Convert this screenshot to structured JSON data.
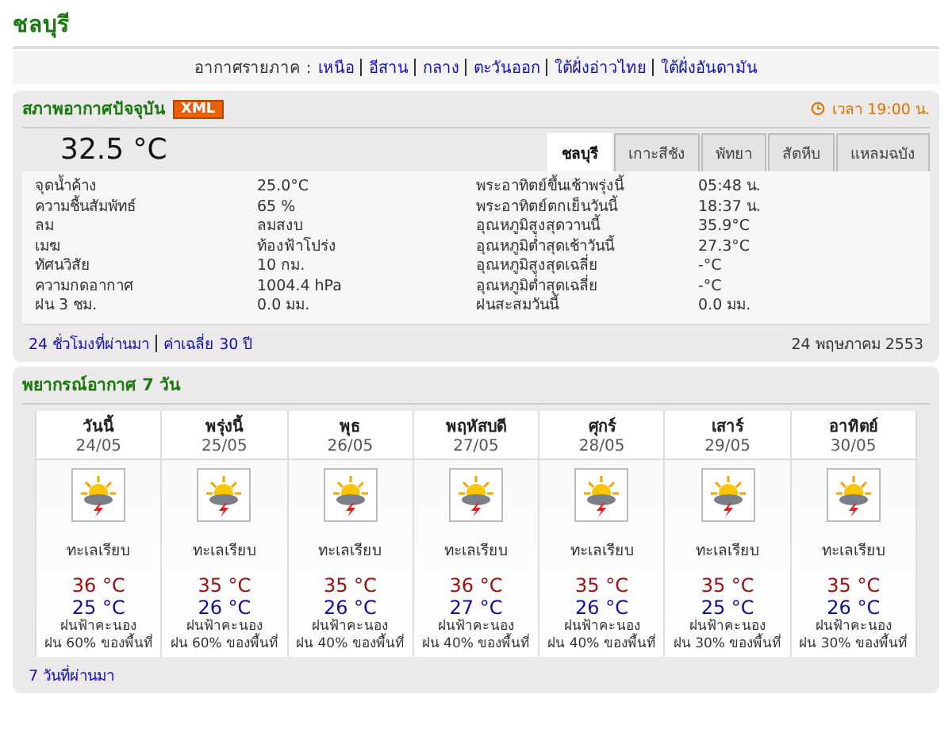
{
  "page_title": "ชลบุรี",
  "region_nav": {
    "label": "อากาศรายภาค :",
    "links": [
      "เหนือ",
      "อีสาน",
      "กลาง",
      "ตะวันออก",
      "ใต้ฝั่งอ่าวไทย",
      "ใต้ฝั่งอันดามัน"
    ]
  },
  "current": {
    "title": "สภาพอากาศปัจจุบัน",
    "badge": "XML",
    "time": "เวลา 19:00 น.",
    "temperature": "32.5 °C",
    "tabs": [
      {
        "label": "ชลบุรี",
        "selected": true
      },
      {
        "label": "เกาะสีชัง",
        "selected": false
      },
      {
        "label": "พัทยา",
        "selected": false
      },
      {
        "label": "สัตหีบ",
        "selected": false
      },
      {
        "label": "แหลมฉบัง",
        "selected": false
      }
    ],
    "left": [
      {
        "label": "จุดน้ำค้าง",
        "value": "25.0°C"
      },
      {
        "label": "ความชื้นสัมพัทธ์",
        "value": "65 %"
      },
      {
        "label": "ลม",
        "value": "ลมสงบ"
      },
      {
        "label": "เมฆ",
        "value": "ท้องฟ้าโปร่ง"
      },
      {
        "label": "ทัศนวิสัย",
        "value": "10 กม."
      },
      {
        "label": "ความกดอากาศ",
        "value": "1004.4 hPa"
      },
      {
        "label": "ฝน 3 ชม.",
        "value": "0.0 มม."
      }
    ],
    "right": [
      {
        "label": "พระอาทิตย์ขึ้นเช้าพรุ่งนี้",
        "value": "05:48 น."
      },
      {
        "label": "พระอาทิตย์ตกเย็นวันนี้",
        "value": "18:37 น."
      },
      {
        "label": "อุณหภูมิสูงสุดวานนี้",
        "value": "35.9°C"
      },
      {
        "label": "อุณหภูมิต่ำสุดเช้าวันนี้",
        "value": "27.3°C"
      },
      {
        "label": "อุณหภูมิสูงสุดเฉลี่ย",
        "value": "-°C"
      },
      {
        "label": "อุณหภูมิต่ำสุดเฉลี่ย",
        "value": "-°C"
      },
      {
        "label": "ฝนสะสมวันนี้",
        "value": "0.0 มม."
      }
    ],
    "footer_links": [
      "24 ชั่วโมงที่ผ่านมา",
      "ค่าเฉลี่ย 30 ปี"
    ],
    "date": "24 พฤษภาคม 2553"
  },
  "forecast": {
    "title": "พยากรณ์อากาศ 7 วัน",
    "days": [
      {
        "day": "วันนี้",
        "date": "24/05",
        "condition": "ทะเลเรียบ",
        "high": "36 °C",
        "low": "25 °C",
        "weather": "ฝนฟ้าคะนอง",
        "rain": "ฝน 60% ของพื้นที่"
      },
      {
        "day": "พรุ่งนี้",
        "date": "25/05",
        "condition": "ทะเลเรียบ",
        "high": "35 °C",
        "low": "26 °C",
        "weather": "ฝนฟ้าคะนอง",
        "rain": "ฝน 60% ของพื้นที่"
      },
      {
        "day": "พุธ",
        "date": "26/05",
        "condition": "ทะเลเรียบ",
        "high": "35 °C",
        "low": "26 °C",
        "weather": "ฝนฟ้าคะนอง",
        "rain": "ฝน 40% ของพื้นที่"
      },
      {
        "day": "พฤหัสบดี",
        "date": "27/05",
        "condition": "ทะเลเรียบ",
        "high": "36 °C",
        "low": "27 °C",
        "weather": "ฝนฟ้าคะนอง",
        "rain": "ฝน 40% ของพื้นที่"
      },
      {
        "day": "ศุกร์",
        "date": "28/05",
        "condition": "ทะเลเรียบ",
        "high": "35 °C",
        "low": "26 °C",
        "weather": "ฝนฟ้าคะนอง",
        "rain": "ฝน 40% ของพื้นที่"
      },
      {
        "day": "เสาร์",
        "date": "29/05",
        "condition": "ทะเลเรียบ",
        "high": "35 °C",
        "low": "25 °C",
        "weather": "ฝนฟ้าคะนอง",
        "rain": "ฝน 30% ของพื้นที่"
      },
      {
        "day": "อาทิตย์",
        "date": "30/05",
        "condition": "ทะเลเรียบ",
        "high": "35 °C",
        "low": "26 °C",
        "weather": "ฝนฟ้าคะนอง",
        "rain": "ฝน 30% ของพื้นที่"
      }
    ],
    "link": "7 วันที่ผ่านมา"
  }
}
